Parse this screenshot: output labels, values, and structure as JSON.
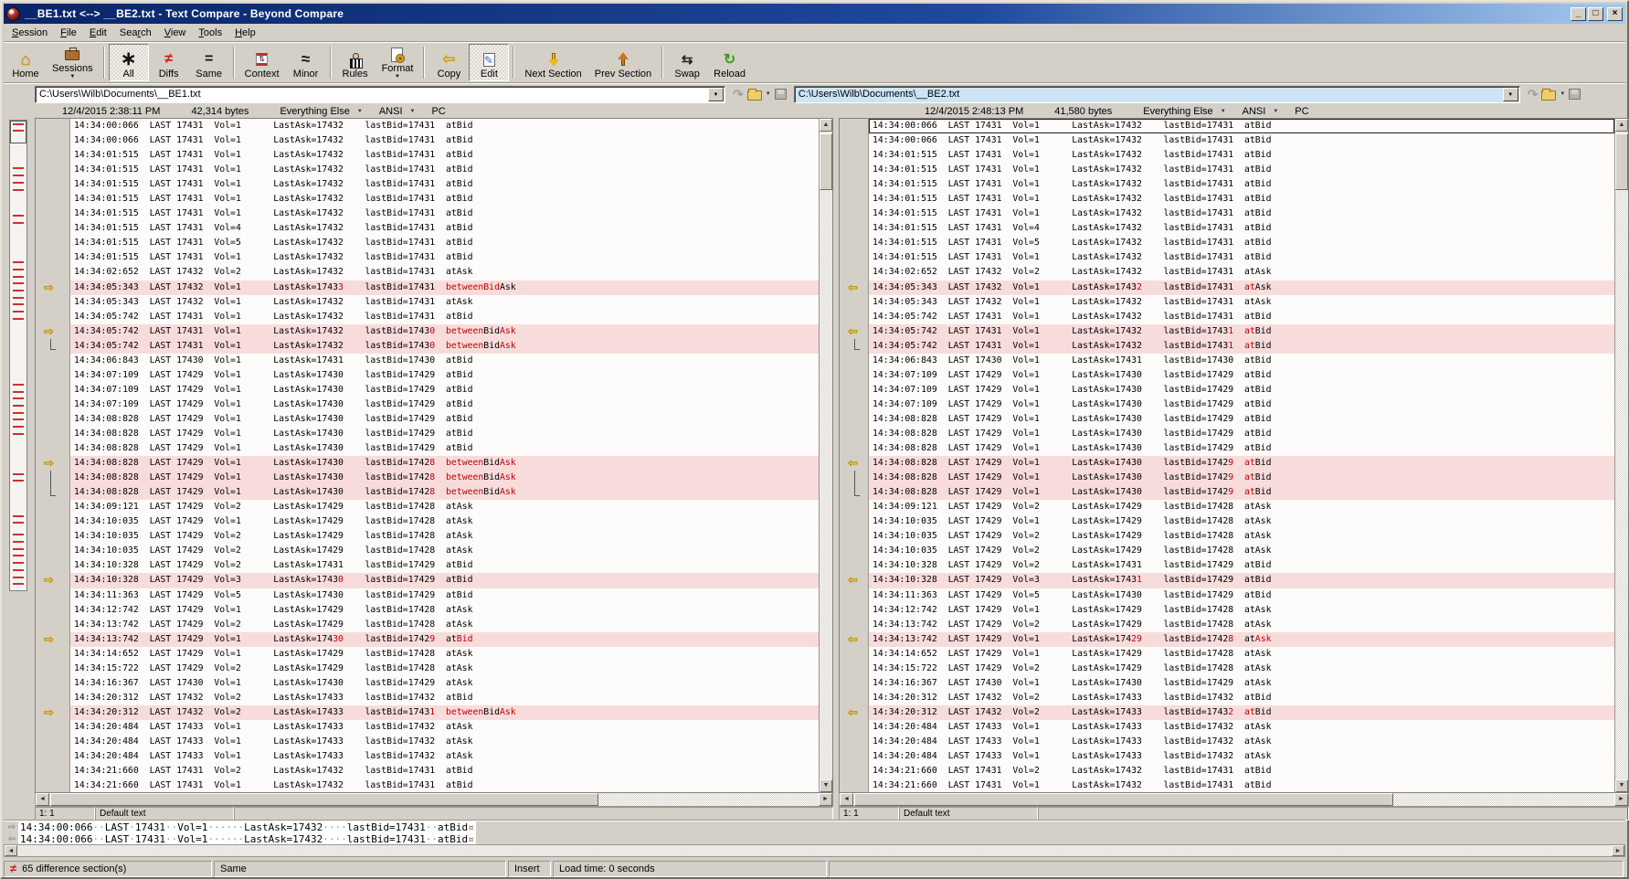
{
  "window": {
    "title": "__BE1.txt <--> __BE2.txt - Text Compare - Beyond Compare",
    "controls": [
      {
        "name": "minimize-button",
        "glyph": "_"
      },
      {
        "name": "maximize-button",
        "glyph": "□"
      },
      {
        "name": "close-button",
        "glyph": "×"
      }
    ]
  },
  "menu": {
    "items": [
      {
        "label": "Session",
        "underline": 0
      },
      {
        "label": "File",
        "underline": 0
      },
      {
        "label": "Edit",
        "underline": 0
      },
      {
        "label": "Search",
        "underline": 3
      },
      {
        "label": "View",
        "underline": 0
      },
      {
        "label": "Tools",
        "underline": 0
      },
      {
        "label": "Help",
        "underline": 0
      }
    ]
  },
  "toolbar": {
    "buttons": [
      {
        "label": "Home",
        "icon": "home-icon"
      },
      {
        "label": "Sessions",
        "icon": "briefcase-icon",
        "dropdown": true
      },
      {
        "separator": true
      },
      {
        "label": "All",
        "icon": "asterisk-icon",
        "pressed": true
      },
      {
        "label": "Diffs",
        "icon": "not-equal-icon"
      },
      {
        "label": "Same",
        "icon": "equals-icon"
      },
      {
        "separator": true
      },
      {
        "label": "Context",
        "icon": "context-icon"
      },
      {
        "label": "Minor",
        "icon": "approx-icon"
      },
      {
        "separator": true
      },
      {
        "label": "Rules",
        "icon": "referee-icon"
      },
      {
        "label": "Format",
        "icon": "format-icon",
        "dropdown": true
      },
      {
        "separator": true
      },
      {
        "label": "Copy",
        "icon": "copy-arrow-icon"
      },
      {
        "label": "Edit",
        "icon": "edit-icon",
        "pressed": true
      },
      {
        "separator": true
      },
      {
        "label": "Next Section",
        "icon": "down-arrow-icon"
      },
      {
        "label": "Prev Section",
        "icon": "up-arrow-icon"
      },
      {
        "separator": true
      },
      {
        "label": "Swap",
        "icon": "swap-icon"
      },
      {
        "label": "Reload",
        "icon": "reload-icon"
      }
    ]
  },
  "panes": {
    "left": {
      "path": "C:\\Users\\Wilb\\Documents\\__BE1.txt",
      "modified": "12/4/2015 2:38:11 PM",
      "size": "42,314 bytes",
      "filter": "Everything Else",
      "encoding": "ANSI",
      "line_ending": "PC",
      "status_position": "1: 1",
      "status_syntax": "Default text",
      "marker_arrow": "⇨"
    },
    "right": {
      "path": "C:\\Users\\Wilb\\Documents\\__BE2.txt",
      "modified": "12/4/2015 2:48:13 PM",
      "size": "41,580 bytes",
      "filter": "Everything Else",
      "encoding": "ANSI",
      "line_ending": "PC",
      "status_position": "1: 1",
      "status_syntax": "Default text",
      "marker_arrow": "⇦"
    }
  },
  "rows": [
    {
      "text": "14:34:00:066  LAST 17431  Vol=1      LastAsk=17432    lastBid=17431  atBid"
    },
    {
      "text": "14:34:00:066  LAST 17431  Vol=1      LastAsk=17432    lastBid=17431  atBid"
    },
    {
      "text": "14:34:01:515  LAST 17431  Vol=1      LastAsk=17432    lastBid=17431  atBid"
    },
    {
      "text": "14:34:01:515  LAST 17431  Vol=1      LastAsk=17432    lastBid=17431  atBid"
    },
    {
      "text": "14:34:01:515  LAST 17431  Vol=1      LastAsk=17432    lastBid=17431  atBid"
    },
    {
      "text": "14:34:01:515  LAST 17431  Vol=1      LastAsk=17432    lastBid=17431  atBid"
    },
    {
      "text": "14:34:01:515  LAST 17431  Vol=1      LastAsk=17432    lastBid=17431  atBid"
    },
    {
      "text": "14:34:01:515  LAST 17431  Vol=4      LastAsk=17432    lastBid=17431  atBid"
    },
    {
      "text": "14:34:01:515  LAST 17431  Vol=5      LastAsk=17432    lastBid=17431  atBid"
    },
    {
      "text": "14:34:01:515  LAST 17431  Vol=1      LastAsk=17432    lastBid=17431  atBid"
    },
    {
      "text": "14:34:02:652  LAST 17432  Vol=2      LastAsk=17432    lastBid=17431  atAsk"
    },
    {
      "diff": true,
      "marker": "arrow",
      "left": [
        [
          "14:34:05:343  LAST 17432  Vol=1      LastAsk=1743",
          0
        ],
        [
          "3",
          1
        ],
        [
          "    lastBid=17431  ",
          0
        ],
        [
          "betweenBid",
          1
        ],
        [
          "Ask",
          0
        ]
      ],
      "right": [
        [
          "14:34:05:343  LAST 17432  Vol=1      LastAsk=1743",
          0
        ],
        [
          "2",
          1
        ],
        [
          "    lastBid=17431  ",
          0
        ],
        [
          "at",
          1
        ],
        [
          "Ask",
          0
        ]
      ]
    },
    {
      "text": "14:34:05:343  LAST 17432  Vol=1      LastAsk=17432    lastBid=17431  atAsk"
    },
    {
      "text": "14:34:05:742  LAST 17431  Vol=1      LastAsk=17432    lastBid=17431  atBid"
    },
    {
      "diff": true,
      "marker": "arrow",
      "left": [
        [
          "14:34:05:742  LAST 17431  Vol=1      LastAsk=17432    lastBid=1743",
          0
        ],
        [
          "0",
          1
        ],
        [
          "  ",
          0
        ],
        [
          "between",
          1
        ],
        [
          "Bid",
          0
        ],
        [
          "Ask",
          1
        ]
      ],
      "right": [
        [
          "14:34:05:742  LAST 17431  Vol=1      LastAsk=17432    lastBid=1743",
          0
        ],
        [
          "1",
          1
        ],
        [
          "  ",
          0
        ],
        [
          "at",
          1
        ],
        [
          "Bid",
          0
        ]
      ]
    },
    {
      "diff": true,
      "marker": "lfoot",
      "left": [
        [
          "14:34:05:742  LAST 17431  Vol=1      LastAsk=17432    lastBid=1743",
          0
        ],
        [
          "0",
          1
        ],
        [
          "  ",
          0
        ],
        [
          "between",
          1
        ],
        [
          "Bid",
          0
        ],
        [
          "Ask",
          1
        ]
      ],
      "right": [
        [
          "14:34:05:742  LAST 17431  Vol=1      LastAsk=17432    lastBid=1743",
          0
        ],
        [
          "1",
          1
        ],
        [
          "  ",
          0
        ],
        [
          "at",
          1
        ],
        [
          "Bid",
          0
        ]
      ]
    },
    {
      "text": "14:34:06:843  LAST 17430  Vol=1      LastAsk=17431    lastBid=17430  atBid"
    },
    {
      "text": "14:34:07:109  LAST 17429  Vol=1      LastAsk=17430    lastBid=17429  atBid"
    },
    {
      "text": "14:34:07:109  LAST 17429  Vol=1      LastAsk=17430    lastBid=17429  atBid"
    },
    {
      "text": "14:34:07:109  LAST 17429  Vol=1      LastAsk=17430    lastBid=17429  atBid"
    },
    {
      "text": "14:34:08:828  LAST 17429  Vol=1      LastAsk=17430    lastBid=17429  atBid"
    },
    {
      "text": "14:34:08:828  LAST 17429  Vol=1      LastAsk=17430    lastBid=17429  atBid"
    },
    {
      "text": "14:34:08:828  LAST 17429  Vol=1      LastAsk=17430    lastBid=17429  atBid"
    },
    {
      "diff": true,
      "marker": "arrow",
      "left": [
        [
          "14:34:08:828  LAST 17429  Vol=1      LastAsk=17430    lastBid=1742",
          0
        ],
        [
          "8",
          1
        ],
        [
          "  ",
          0
        ],
        [
          "between",
          1
        ],
        [
          "Bid",
          0
        ],
        [
          "Ask",
          1
        ]
      ],
      "right": [
        [
          "14:34:08:828  LAST 17429  Vol=1      LastAsk=17430    lastBid=1742",
          0
        ],
        [
          "9",
          1
        ],
        [
          "  ",
          0
        ],
        [
          "at",
          1
        ],
        [
          "Bid",
          0
        ]
      ]
    },
    {
      "diff": true,
      "marker": "vline",
      "left": [
        [
          "14:34:08:828  LAST 17429  Vol=1      LastAsk=17430    lastBid=1742",
          0
        ],
        [
          "8",
          1
        ],
        [
          "  ",
          0
        ],
        [
          "between",
          1
        ],
        [
          "Bid",
          0
        ],
        [
          "Ask",
          1
        ]
      ],
      "right": [
        [
          "14:34:08:828  LAST 17429  Vol=1      LastAsk=17430    lastBid=1742",
          0
        ],
        [
          "9",
          1
        ],
        [
          "  ",
          0
        ],
        [
          "at",
          1
        ],
        [
          "Bid",
          0
        ]
      ]
    },
    {
      "diff": true,
      "marker": "lfoot",
      "left": [
        [
          "14:34:08:828  LAST 17429  Vol=1      LastAsk=17430    lastBid=1742",
          0
        ],
        [
          "8",
          1
        ],
        [
          "  ",
          0
        ],
        [
          "between",
          1
        ],
        [
          "Bid",
          0
        ],
        [
          "Ask",
          1
        ]
      ],
      "right": [
        [
          "14:34:08:828  LAST 17429  Vol=1      LastAsk=17430    lastBid=1742",
          0
        ],
        [
          "9",
          1
        ],
        [
          "  ",
          0
        ],
        [
          "at",
          1
        ],
        [
          "Bid",
          0
        ]
      ]
    },
    {
      "text": "14:34:09:121  LAST 17429  Vol=2      LastAsk=17429    lastBid=17428  atAsk"
    },
    {
      "text": "14:34:10:035  LAST 17429  Vol=1      LastAsk=17429    lastBid=17428  atAsk"
    },
    {
      "text": "14:34:10:035  LAST 17429  Vol=2      LastAsk=17429    lastBid=17428  atAsk"
    },
    {
      "text": "14:34:10:035  LAST 17429  Vol=2      LastAsk=17429    lastBid=17428  atAsk"
    },
    {
      "text": "14:34:10:328  LAST 17429  Vol=2      LastAsk=17431    lastBid=17429  atBid"
    },
    {
      "diff": true,
      "marker": "arrow",
      "left": [
        [
          "14:34:10:328  LAST 17429  Vol=3      LastAsk=1743",
          0
        ],
        [
          "0",
          1
        ],
        [
          "    lastBid=17429  atBid",
          0
        ]
      ],
      "right": [
        [
          "14:34:10:328  LAST 17429  Vol=3      LastAsk=1743",
          0
        ],
        [
          "1",
          1
        ],
        [
          "    lastBid=17429  atBid",
          0
        ]
      ]
    },
    {
      "text": "14:34:11:363  LAST 17429  Vol=5      LastAsk=17430    lastBid=17429  atBid"
    },
    {
      "text": "14:34:12:742  LAST 17429  Vol=1      LastAsk=17429    lastBid=17428  atAsk"
    },
    {
      "text": "14:34:13:742  LAST 17429  Vol=2      LastAsk=17429    lastBid=17428  atAsk"
    },
    {
      "diff": true,
      "marker": "arrow",
      "left": [
        [
          "14:34:13:742  LAST 17429  Vol=1      LastAsk=174",
          0
        ],
        [
          "30",
          1
        ],
        [
          "    lastBid=1742",
          0
        ],
        [
          "9",
          1
        ],
        [
          "  at",
          0
        ],
        [
          "Bid",
          1
        ]
      ],
      "right": [
        [
          "14:34:13:742  LAST 17429  Vol=1      LastAsk=174",
          0
        ],
        [
          "29",
          1
        ],
        [
          "    lastBid=1742",
          0
        ],
        [
          "8",
          1
        ],
        [
          "  at",
          0
        ],
        [
          "Ask",
          1
        ]
      ]
    },
    {
      "text": "14:34:14:652  LAST 17429  Vol=1      LastAsk=17429    lastBid=17428  atAsk"
    },
    {
      "text": "14:34:15:722  LAST 17429  Vol=2      LastAsk=17429    lastBid=17428  atAsk"
    },
    {
      "text": "14:34:16:367  LAST 17430  Vol=1      LastAsk=17430    lastBid=17429  atAsk"
    },
    {
      "text": "14:34:20:312  LAST 17432  Vol=2      LastAsk=17433    lastBid=17432  atBid"
    },
    {
      "diff": true,
      "marker": "arrow",
      "left": [
        [
          "14:34:20:312  LAST 17432  Vol=2      LastAsk=17433    lastBid=1743",
          0
        ],
        [
          "1",
          1
        ],
        [
          "  ",
          0
        ],
        [
          "between",
          1
        ],
        [
          "Bid",
          0
        ],
        [
          "Ask",
          1
        ]
      ],
      "right": [
        [
          "14:34:20:312  LAST 17432  Vol=2      LastAsk=17433    lastBid=1743",
          0
        ],
        [
          "2",
          1
        ],
        [
          "  ",
          0
        ],
        [
          "at",
          1
        ],
        [
          "Bid",
          0
        ]
      ]
    },
    {
      "text": "14:34:20:484  LAST 17433  Vol=1      LastAsk=17433    lastBid=17432  atAsk"
    },
    {
      "text": "14:34:20:484  LAST 17433  Vol=1      LastAsk=17433    lastBid=17432  atAsk"
    },
    {
      "text": "14:34:20:484  LAST 17433  Vol=1      LastAsk=17433    lastBid=17432  atAsk"
    },
    {
      "text": "14:34:21:660  LAST 17431  Vol=2      LastAsk=17432    lastBid=17431  atBid"
    },
    {
      "text": "14:34:21:660  LAST 17431  Vol=1      LastAsk=17432    lastBid=17431  atBid"
    },
    {
      "text": "14:34:21:660  LAST 17431  Vol=1      LastAsk=17432    lastBid=17431  atBid"
    }
  ],
  "detail_panel": {
    "lines": [
      {
        "arrow": "⇨",
        "text": "14:34:00:066··LAST·17431··Vol=1······LastAsk=17432····lastBid=17431··atBid",
        "eol": "¤"
      },
      {
        "arrow": "⇦",
        "text": "14:34:00:066··LAST·17431··Vol=1······LastAsk=17432····lastBid=17431··atBid",
        "eol": "¤"
      }
    ]
  },
  "status_bar": {
    "diff_count": "65 difference section(s)",
    "compare_state": "Same",
    "edit_mode": "Insert",
    "load_time": "Load time: 0 seconds"
  },
  "minimap": {
    "marks": [
      0.006,
      0.02,
      0.1,
      0.115,
      0.13,
      0.145,
      0.2,
      0.215,
      0.3,
      0.315,
      0.33,
      0.345,
      0.36,
      0.375,
      0.39,
      0.405,
      0.42,
      0.56,
      0.575,
      0.59,
      0.605,
      0.62,
      0.635,
      0.65,
      0.665,
      0.75,
      0.765,
      0.84,
      0.855,
      0.88,
      0.895,
      0.91,
      0.925,
      0.94,
      0.955,
      0.97,
      0.985
    ]
  },
  "colors": {
    "diff_row_bg": "#f8dcdc",
    "diff_text": "#c00000",
    "focused_path_bg": "#cde4f6",
    "titlebar_start": "#0a246a",
    "titlebar_end": "#a6caf0",
    "chrome_gray": "#d4d0c8",
    "marker_gold": "#c79600",
    "minimap_mark": "#cc3030"
  }
}
